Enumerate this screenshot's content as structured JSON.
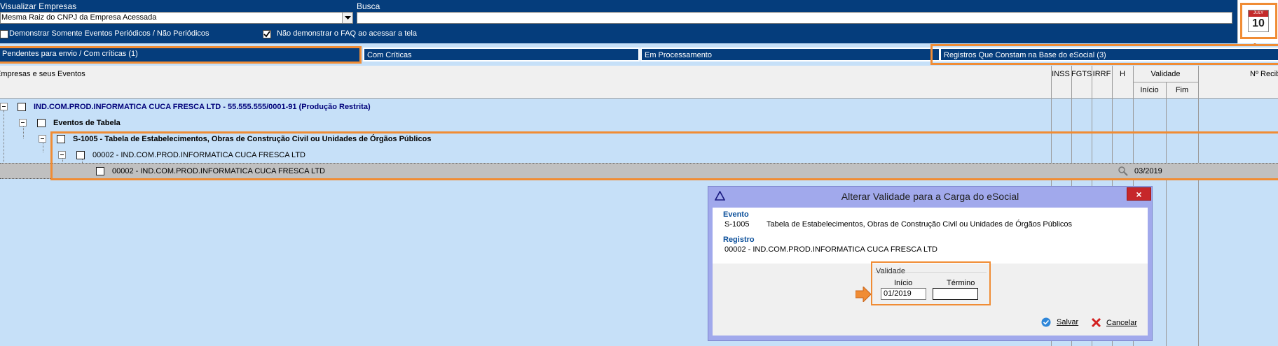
{
  "filters": {
    "visualizar_label": "Visualizar Empresas",
    "visualizar_value": "Mesma Raiz do CNPJ da Empresa Acessada",
    "busca_label": "Busca",
    "busca_value": "",
    "check_periodicos_label": "Demonstrar Somente Eventos Periódicos / Não Periódicos",
    "check_periodicos_checked": false,
    "check_faq_label": "Não demonstrar o FAQ ao acessar a tela",
    "check_faq_checked": true
  },
  "calendar": {
    "month": "JULY",
    "day": "10"
  },
  "tabs": [
    {
      "label": "Pendentes para envio / Com críticas (1)",
      "active": true
    },
    {
      "label": "Com Críticas",
      "active": false
    },
    {
      "label": "Em Processamento",
      "active": false
    },
    {
      "label": "Registros Que Constam na Base do eSocial (3)",
      "active": false
    }
  ],
  "grid": {
    "header_main": "Empresas e seus Eventos",
    "col_inss": "INSS",
    "col_fgts": "FGTS",
    "col_irrf": "IRRF",
    "col_h": "H",
    "col_validade": "Validade",
    "col_inicio": "Início",
    "col_fim": "Fim",
    "col_recibo": "Nº Recibo",
    "rows": [
      {
        "text": "IND.COM.PROD.INFORMATICA CUCA FRESCA LTD - 55.555.555/0001-91 (Produção Restrita)"
      },
      {
        "text": "Eventos de Tabela"
      },
      {
        "text": "S-1005 - Tabela de Estabelecimentos, Obras de Construção Civil ou Unidades de Órgãos Públicos"
      },
      {
        "text": "00002 - IND.COM.PROD.INFORMATICA CUCA FRESCA LTD"
      },
      {
        "text": "00002 - IND.COM.PROD.INFORMATICA CUCA FRESCA LTD",
        "inicio": "03/2019"
      }
    ]
  },
  "dialog": {
    "title": "Alterar Validade para a Carga do eSocial",
    "close": "×",
    "evento_label": "Evento",
    "evento_code": "S-1005",
    "evento_desc": "Tabela de Estabelecimentos, Obras de Construção Civil ou Unidades de Órgãos Públicos",
    "registro_label": "Registro",
    "registro_value": "00002 - IND.COM.PROD.INFORMATICA CUCA FRESCA LTD",
    "validade_label": "Validade",
    "inicio_label": "Início",
    "inicio_value": "01/2019",
    "termino_label": "Término",
    "termino_value": "",
    "salvar": "Salvar",
    "cancelar": "Cancelar"
  },
  "colors": {
    "header_bg": "#053d7c",
    "highlight": "#f08c34",
    "grid_bg": "#c6e0f8",
    "dialog_bg": "#a1a9ec"
  }
}
